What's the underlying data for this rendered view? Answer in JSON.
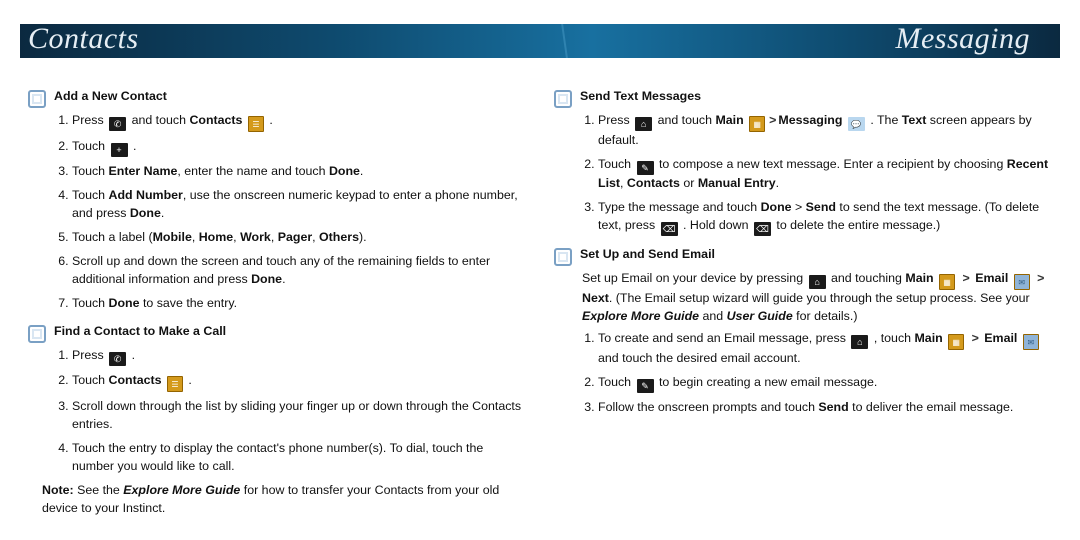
{
  "banner": {
    "left": "Contacts",
    "right": "Messaging"
  },
  "left": {
    "section1": {
      "title": "Add a New Contact",
      "steps": {
        "s1a": "Press ",
        "s1b": " and touch ",
        "s1c": "Contacts",
        "s1d": " .",
        "s2a": "Touch ",
        "s2b": " .",
        "s3a": "Touch ",
        "s3b": "Enter Name",
        "s3c": ", enter the name and touch ",
        "s3d": "Done",
        "s3e": ".",
        "s4a": "Touch ",
        "s4b": "Add Number",
        "s4c": ", use the onscreen numeric keypad to enter a phone number, and press ",
        "s4d": "Done",
        "s4e": ".",
        "s5a": "Touch a label (",
        "s5b": "Mobile",
        "s5c": ", ",
        "s5d": "Home",
        "s5e": ", ",
        "s5f": "Work",
        "s5g": ", ",
        "s5h": "Pager",
        "s5i": ", ",
        "s5j": "Others",
        "s5k": ").",
        "s6a": "Scroll up and down the screen and touch any of the remaining fields to enter additional information and press ",
        "s6b": "Done",
        "s6c": ".",
        "s7a": "Touch ",
        "s7b": "Done",
        "s7c": " to save the entry."
      }
    },
    "section2": {
      "title": "Find a Contact to Make a Call",
      "steps": {
        "s1a": "Press ",
        "s1b": " .",
        "s2a": "Touch ",
        "s2b": "Contacts",
        "s2c": " .",
        "s3": "Scroll down through the list by sliding your finger up or down through the Contacts entries.",
        "s4": "Touch the entry to display the contact's phone number(s). To dial, touch the number you would like to call."
      },
      "noteLabel": "Note:",
      "noteA": " See the ",
      "noteB": "Explore More Guide",
      "noteC": " for how to transfer your Contacts from your old device to your Instinct."
    }
  },
  "right": {
    "section1": {
      "title": "Send Text Messages",
      "steps": {
        "s1a": "Press ",
        "s1b": " and touch ",
        "s1c": "Main",
        "s1d": " ",
        "s1e": "Messaging",
        "s1f": " . The ",
        "s1g": "Text",
        "s1h": " screen appears by default.",
        "s2a": "Touch ",
        "s2b": " to compose a new text message. Enter a recipient by choosing ",
        "s2c": "Recent List",
        "s2d": ", ",
        "s2e": "Contacts",
        "s2f": " or ",
        "s2g": "Manual Entry",
        "s2h": ".",
        "s3a": "Type the message and touch ",
        "s3b": "Done",
        "s3c": " > ",
        "s3d": "Send",
        "s3e": " to send the text message. (To delete text, press ",
        "s3f": " . Hold down ",
        "s3g": " to delete the entire message.)"
      }
    },
    "section2": {
      "title": "Set Up and Send Email",
      "introA": "Set up Email on your device by pressing ",
      "introB": " and touching ",
      "introC": "Main",
      "introD": " > ",
      "introE": "Email",
      "introF": " > ",
      "introG": "Next",
      "introH": ". (The Email setup wizard will guide you through the setup process. See your ",
      "introI": "Explore More Guide",
      "introJ": " and ",
      "introK": "User Guide",
      "introL": " for details.)",
      "steps": {
        "s1a": "To create and send an Email message, press ",
        "s1b": " , touch ",
        "s1c": "Main",
        "s1d": " > ",
        "s1e": "Email",
        "s1f": " and touch the desired email account.",
        "s2a": "Touch ",
        "s2b": " to begin creating a new email message.",
        "s3a": "Follow the onscreen prompts and touch ",
        "s3b": "Send",
        "s3c": " to deliver the email message."
      }
    }
  }
}
